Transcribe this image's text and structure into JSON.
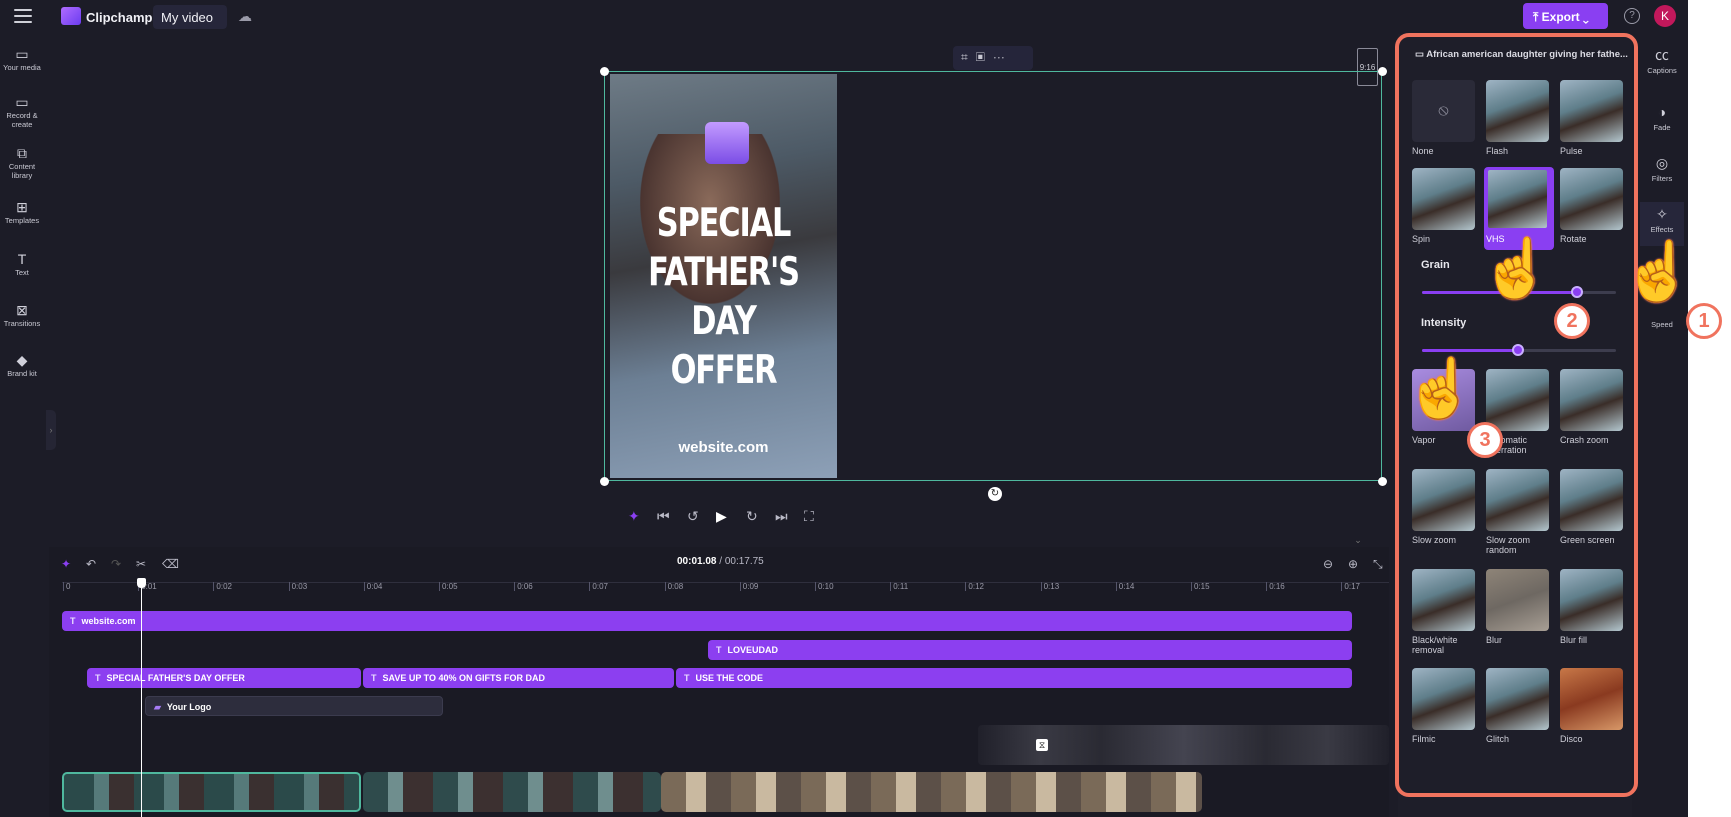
{
  "app": {
    "brand": "Clipchamp",
    "video_title": "My video",
    "export_label": "Export",
    "help": "?",
    "avatar": "K"
  },
  "left_rail": [
    {
      "label": "Your media",
      "icon": "folder-icon"
    },
    {
      "label": "Record & create",
      "icon": "camera-icon"
    },
    {
      "label": "Content library",
      "icon": "library-icon"
    },
    {
      "label": "Templates",
      "icon": "templates-icon"
    },
    {
      "label": "Text",
      "icon": "text-icon"
    },
    {
      "label": "Transitions",
      "icon": "transitions-icon"
    },
    {
      "label": "Brand kit",
      "icon": "brand-kit-icon"
    }
  ],
  "preview": {
    "headline": "SPECIAL FATHER'S DAY OFFER",
    "footer": "website.com",
    "aspect_ratio": "9:16"
  },
  "timeline": {
    "current_time": "00:01.08",
    "total_time": "/ 00:17.75",
    "ticks": [
      "0",
      "0:01",
      "0:02",
      "0:03",
      "0:04",
      "0:05",
      "0:06",
      "0:07",
      "0:08",
      "0:09",
      "0:10",
      "0:11",
      "0:12",
      "0:13",
      "0:14",
      "0:15",
      "0:16",
      "0:17"
    ],
    "text_clips": [
      "website.com",
      "LOVEUDAD",
      "SPECIAL FATHER'S DAY OFFER",
      "SAVE UP TO 40% ON GIFTS FOR DAD",
      "USE THE CODE"
    ],
    "logo_clip": "Your Logo"
  },
  "effects_panel": {
    "title": "African american daughter giving her fathe...",
    "effects": [
      "None",
      "Flash",
      "Pulse",
      "Spin",
      "VHS",
      "Rotate",
      "Vapor",
      "Chromatic aberration",
      "Crash zoom",
      "Slow zoom",
      "Slow zoom random",
      "Green screen",
      "Black/white removal",
      "Blur",
      "Blur fill",
      "Filmic",
      "Glitch",
      "Disco"
    ],
    "selected": "VHS",
    "grain_label": "Grain",
    "grain_value": 0.8,
    "intensity_label": "Intensity",
    "intensity_value": 0.5
  },
  "right_rail": [
    {
      "label": "Captions",
      "icon": "captions-icon"
    },
    {
      "label": "Fade",
      "icon": "fade-icon"
    },
    {
      "label": "Filters",
      "icon": "filters-icon"
    },
    {
      "label": "Effects",
      "icon": "effects-icon"
    },
    {
      "label": "Speed",
      "icon": "speed-icon"
    }
  ],
  "annotations": [
    "1",
    "2",
    "3"
  ],
  "colors": {
    "accent": "#8a3ff2",
    "highlight": "#f0735e",
    "selection": "#4fb89e"
  }
}
